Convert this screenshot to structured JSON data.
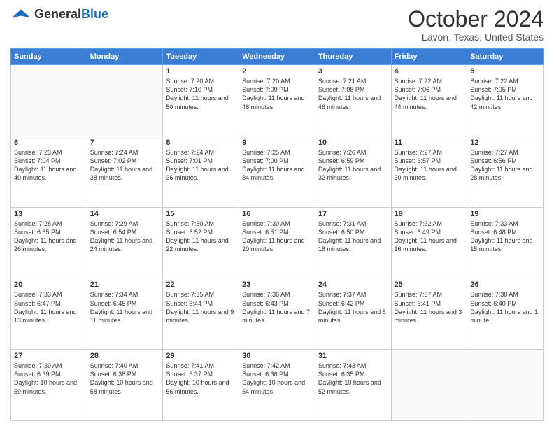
{
  "header": {
    "logo_general": "General",
    "logo_blue": "Blue",
    "month_title": "October 2024",
    "location": "Lavon, Texas, United States"
  },
  "weekdays": [
    "Sunday",
    "Monday",
    "Tuesday",
    "Wednesday",
    "Thursday",
    "Friday",
    "Saturday"
  ],
  "weeks": [
    [
      {
        "day": null
      },
      {
        "day": null
      },
      {
        "day": 1,
        "sunrise": "7:20 AM",
        "sunset": "7:10 PM",
        "daylight": "11 hours and 50 minutes."
      },
      {
        "day": 2,
        "sunrise": "7:20 AM",
        "sunset": "7:09 PM",
        "daylight": "11 hours and 48 minutes."
      },
      {
        "day": 3,
        "sunrise": "7:21 AM",
        "sunset": "7:08 PM",
        "daylight": "11 hours and 46 minutes."
      },
      {
        "day": 4,
        "sunrise": "7:22 AM",
        "sunset": "7:06 PM",
        "daylight": "11 hours and 44 minutes."
      },
      {
        "day": 5,
        "sunrise": "7:22 AM",
        "sunset": "7:05 PM",
        "daylight": "11 hours and 42 minutes."
      }
    ],
    [
      {
        "day": 6,
        "sunrise": "7:23 AM",
        "sunset": "7:04 PM",
        "daylight": "11 hours and 40 minutes."
      },
      {
        "day": 7,
        "sunrise": "7:24 AM",
        "sunset": "7:02 PM",
        "daylight": "11 hours and 38 minutes."
      },
      {
        "day": 8,
        "sunrise": "7:24 AM",
        "sunset": "7:01 PM",
        "daylight": "11 hours and 36 minutes."
      },
      {
        "day": 9,
        "sunrise": "7:25 AM",
        "sunset": "7:00 PM",
        "daylight": "11 hours and 34 minutes."
      },
      {
        "day": 10,
        "sunrise": "7:26 AM",
        "sunset": "6:59 PM",
        "daylight": "11 hours and 32 minutes."
      },
      {
        "day": 11,
        "sunrise": "7:27 AM",
        "sunset": "6:57 PM",
        "daylight": "11 hours and 30 minutes."
      },
      {
        "day": 12,
        "sunrise": "7:27 AM",
        "sunset": "6:56 PM",
        "daylight": "11 hours and 28 minutes."
      }
    ],
    [
      {
        "day": 13,
        "sunrise": "7:28 AM",
        "sunset": "6:55 PM",
        "daylight": "11 hours and 26 minutes."
      },
      {
        "day": 14,
        "sunrise": "7:29 AM",
        "sunset": "6:54 PM",
        "daylight": "11 hours and 24 minutes."
      },
      {
        "day": 15,
        "sunrise": "7:30 AM",
        "sunset": "6:52 PM",
        "daylight": "11 hours and 22 minutes."
      },
      {
        "day": 16,
        "sunrise": "7:30 AM",
        "sunset": "6:51 PM",
        "daylight": "11 hours and 20 minutes."
      },
      {
        "day": 17,
        "sunrise": "7:31 AM",
        "sunset": "6:50 PM",
        "daylight": "11 hours and 18 minutes."
      },
      {
        "day": 18,
        "sunrise": "7:32 AM",
        "sunset": "6:49 PM",
        "daylight": "11 hours and 16 minutes."
      },
      {
        "day": 19,
        "sunrise": "7:33 AM",
        "sunset": "6:48 PM",
        "daylight": "11 hours and 15 minutes."
      }
    ],
    [
      {
        "day": 20,
        "sunrise": "7:33 AM",
        "sunset": "6:47 PM",
        "daylight": "11 hours and 13 minutes."
      },
      {
        "day": 21,
        "sunrise": "7:34 AM",
        "sunset": "6:45 PM",
        "daylight": "11 hours and 11 minutes."
      },
      {
        "day": 22,
        "sunrise": "7:35 AM",
        "sunset": "6:44 PM",
        "daylight": "11 hours and 9 minutes."
      },
      {
        "day": 23,
        "sunrise": "7:36 AM",
        "sunset": "6:43 PM",
        "daylight": "11 hours and 7 minutes."
      },
      {
        "day": 24,
        "sunrise": "7:37 AM",
        "sunset": "6:42 PM",
        "daylight": "11 hours and 5 minutes."
      },
      {
        "day": 25,
        "sunrise": "7:37 AM",
        "sunset": "6:41 PM",
        "daylight": "11 hours and 3 minutes."
      },
      {
        "day": 26,
        "sunrise": "7:38 AM",
        "sunset": "6:40 PM",
        "daylight": "11 hours and 1 minute."
      }
    ],
    [
      {
        "day": 27,
        "sunrise": "7:39 AM",
        "sunset": "6:39 PM",
        "daylight": "10 hours and 59 minutes."
      },
      {
        "day": 28,
        "sunrise": "7:40 AM",
        "sunset": "6:38 PM",
        "daylight": "10 hours and 58 minutes."
      },
      {
        "day": 29,
        "sunrise": "7:41 AM",
        "sunset": "6:37 PM",
        "daylight": "10 hours and 56 minutes."
      },
      {
        "day": 30,
        "sunrise": "7:42 AM",
        "sunset": "6:36 PM",
        "daylight": "10 hours and 54 minutes."
      },
      {
        "day": 31,
        "sunrise": "7:43 AM",
        "sunset": "6:35 PM",
        "daylight": "10 hours and 52 minutes."
      },
      {
        "day": null
      },
      {
        "day": null
      }
    ]
  ]
}
